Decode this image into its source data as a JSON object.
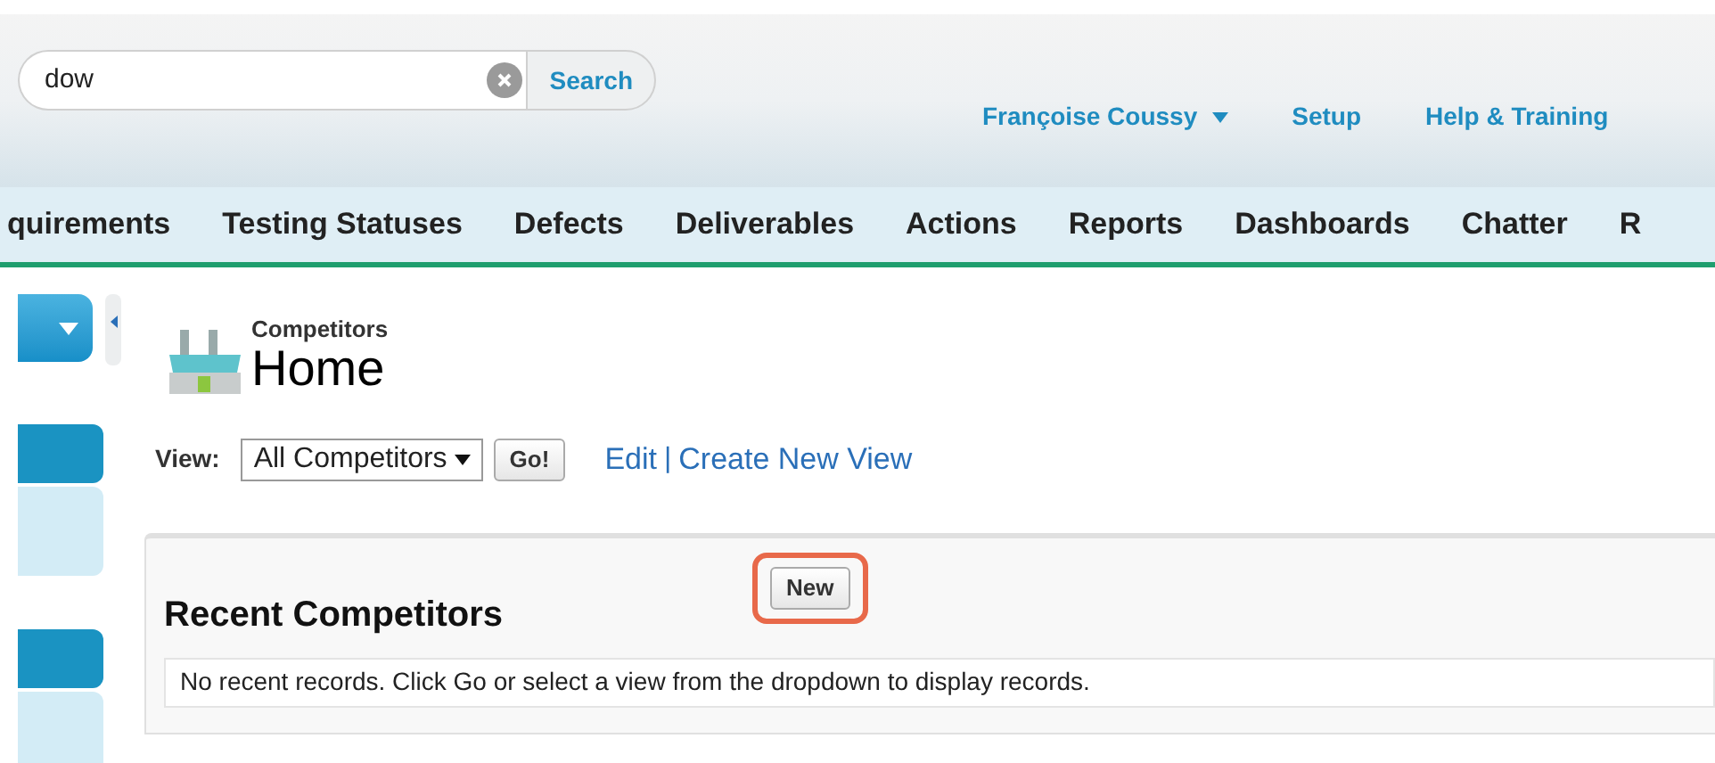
{
  "search": {
    "value": "dow",
    "button": "Search"
  },
  "header_links": [
    {
      "kind": "menu",
      "label": "Françoise Coussy"
    },
    {
      "kind": "link",
      "label": "Setup"
    },
    {
      "kind": "link",
      "label": "Help & Training"
    }
  ],
  "nav_tabs": [
    "quirements",
    "Testing Statuses",
    "Defects",
    "Deliverables",
    "Actions",
    "Reports",
    "Dashboards",
    "Chatter",
    "R"
  ],
  "page": {
    "object": "Competitors",
    "title": "Home"
  },
  "view": {
    "label": "View:",
    "selected": "All Competitors",
    "go": "Go!",
    "edit": "Edit",
    "separator": "|",
    "create": "Create New View"
  },
  "recent": {
    "title": "Recent Competitors",
    "new_button": "New",
    "message": "No recent records. Click Go or select a view from the dropdown to display records."
  }
}
